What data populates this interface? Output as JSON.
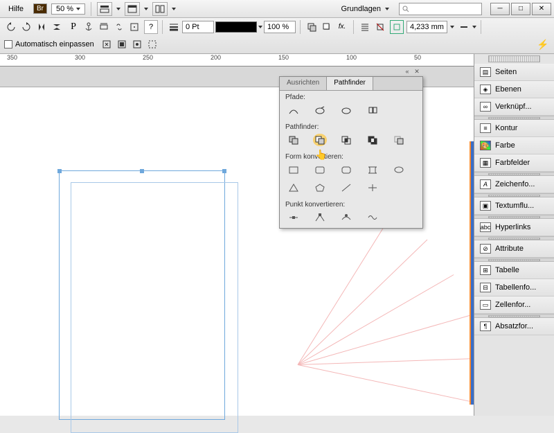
{
  "menu": {
    "help_label": "Hilfe",
    "bridge_badge": "Br",
    "zoom_value": "50 %"
  },
  "workspace": {
    "label": "Grundlagen"
  },
  "search": {
    "placeholder": ""
  },
  "toolbar": {
    "pt_value": "0 Pt",
    "percent_value": "100 %",
    "measure_value": "4,233 mm",
    "autofit_label": "Automatisch einpassen"
  },
  "ruler": {
    "ticks": [
      "350",
      "300",
      "250",
      "200",
      "150",
      "100",
      "50"
    ]
  },
  "panel": {
    "tab_align": "Ausrichten",
    "tab_pathfinder": "Pathfinder",
    "section_paths": "Pfade:",
    "section_pathfinder": "Pathfinder:",
    "section_convert_shape": "Form konvertieren:",
    "section_convert_point": "Punkt konvertieren:"
  },
  "dock": {
    "items": [
      {
        "label": "Seiten",
        "sep_before": false
      },
      {
        "label": "Ebenen",
        "sep_before": false
      },
      {
        "label": "Verknüpf...",
        "sep_before": false
      },
      {
        "label": "Kontur",
        "sep_before": true
      },
      {
        "label": "Farbe",
        "sep_before": false
      },
      {
        "label": "Farbfelder",
        "sep_before": false
      },
      {
        "label": "Zeichenfo...",
        "sep_before": true
      },
      {
        "label": "Textumflu...",
        "sep_before": true
      },
      {
        "label": "Hyperlinks",
        "sep_before": true
      },
      {
        "label": "Attribute",
        "sep_before": true
      },
      {
        "label": "Tabelle",
        "sep_before": true
      },
      {
        "label": "Tabellenfo...",
        "sep_before": false
      },
      {
        "label": "Zellenfor...",
        "sep_before": false
      },
      {
        "label": "Absatzfor...",
        "sep_before": true
      }
    ]
  },
  "colors": {
    "accent": "#6fa8dc",
    "highlight": "#f5c65a"
  }
}
